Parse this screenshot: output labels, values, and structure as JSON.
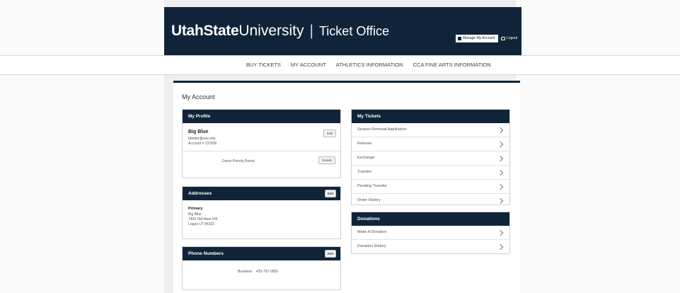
{
  "header": {
    "brand_bold": "UtahState",
    "brand_regular": "University",
    "brand_sep": "|",
    "brand_office": "Ticket Office",
    "manage_button_label": "Manage My Account",
    "logout_label": "Logout"
  },
  "nav": {
    "items": [
      {
        "label": "BUY TICKETS"
      },
      {
        "label": "MY ACCOUNT"
      },
      {
        "label": "ATHLETICS INFORMATION"
      },
      {
        "label": "CCA FINE ARTS INFORMATION"
      }
    ]
  },
  "page": {
    "title": "My Account"
  },
  "profile": {
    "heading": "My Profile",
    "name": "Big Blue",
    "email": "bbetter@usu.edu",
    "account": "Account # 137836",
    "edit_label": "Edit",
    "donor_label": "Donor Priority Points",
    "details_label": "Details"
  },
  "addresses": {
    "heading": "Addresses",
    "edit_label": "Edit",
    "type": "Primary",
    "name": "Big Blue",
    "street": "7400 Old Main Hill",
    "city": "Logan UT 84322"
  },
  "phones": {
    "heading": "Phone Numbers",
    "edit_label": "Edit",
    "line": "Business    435-797-0505"
  },
  "tickets": {
    "heading": "My Tickets",
    "items": [
      {
        "label": "Season Renewal Application"
      },
      {
        "label": "Release"
      },
      {
        "label": "Exchange"
      },
      {
        "label": "Transfer"
      },
      {
        "label": "Pending Transfer"
      },
      {
        "label": "Order History"
      }
    ]
  },
  "donations": {
    "heading": "Donations",
    "items": [
      {
        "label": "Make A Donation"
      },
      {
        "label": "Donation History"
      }
    ]
  }
}
